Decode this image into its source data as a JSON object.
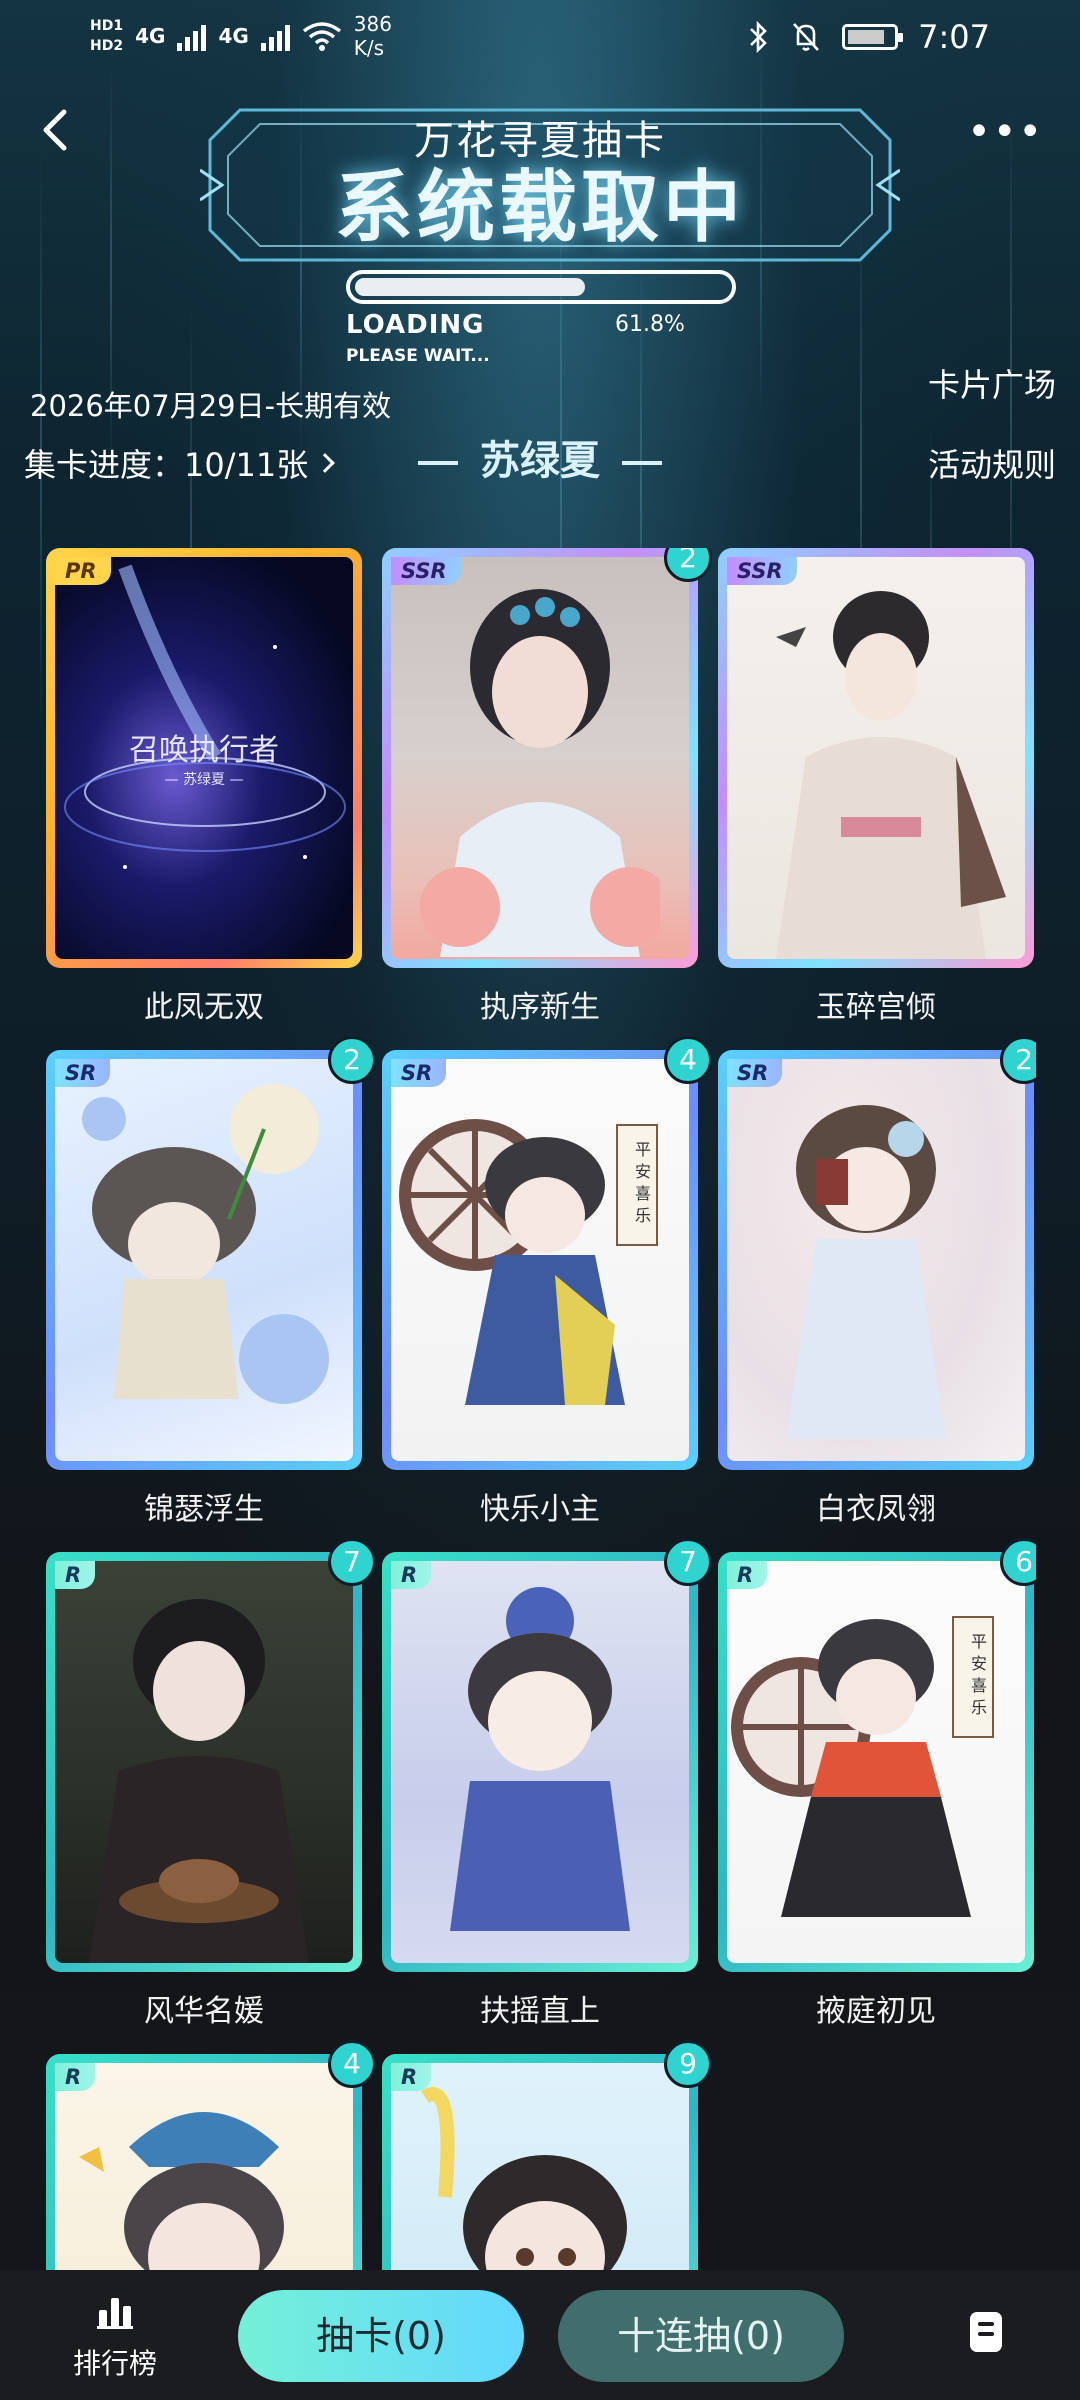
{
  "status_bar": {
    "hd1": "HD1",
    "hd2": "HD2",
    "net1": "4G",
    "net2": "4G",
    "speed_value": "386",
    "speed_unit": "K/s",
    "time": "7:07"
  },
  "header": {
    "title_small": "万花寻夏抽卡",
    "title_big": "系统载取中",
    "progress": 0.618,
    "loading_label": "LOADING",
    "wait_label": "PLEASE WAIT...",
    "percent_label": "61.8%"
  },
  "info": {
    "date_text": "2026年07月29日-长期有效",
    "collect_text": "集卡进度：10/11张",
    "heroine": "苏绿夏",
    "square_link": "卡片广场",
    "rules_link": "活动规则"
  },
  "cards": [
    {
      "rarity": "PR",
      "count": "",
      "name": "此凤无双",
      "art_title": "召唤执行者",
      "art_sub": "— 苏绿夏 —"
    },
    {
      "rarity": "SSR",
      "count": "2",
      "name": "执序新生"
    },
    {
      "rarity": "SSR",
      "count": "",
      "name": "玉碎宫倾"
    },
    {
      "rarity": "SR",
      "count": "2",
      "name": "锦瑟浮生"
    },
    {
      "rarity": "SR",
      "count": "4",
      "name": "快乐小主",
      "art_scroll": "平安喜乐"
    },
    {
      "rarity": "SR",
      "count": "2",
      "name": "白衣凤翎"
    },
    {
      "rarity": "R",
      "count": "7",
      "name": "风华名媛"
    },
    {
      "rarity": "R",
      "count": "7",
      "name": "扶摇直上"
    },
    {
      "rarity": "R",
      "count": "6",
      "name": "掖庭初见",
      "art_scroll": "平安喜乐"
    },
    {
      "rarity": "R",
      "count": "4",
      "name": ""
    },
    {
      "rarity": "R",
      "count": "9",
      "name": ""
    }
  ],
  "bottom_bar": {
    "rank_label": "排行榜",
    "draw_label": "抽卡(0)",
    "ten_draw_label": "十连抽(0)"
  },
  "colors": {
    "accent_teal": "#2fd4d0",
    "draw_button": "#74f0d6",
    "ten_draw_button": "#3f6e6c"
  }
}
